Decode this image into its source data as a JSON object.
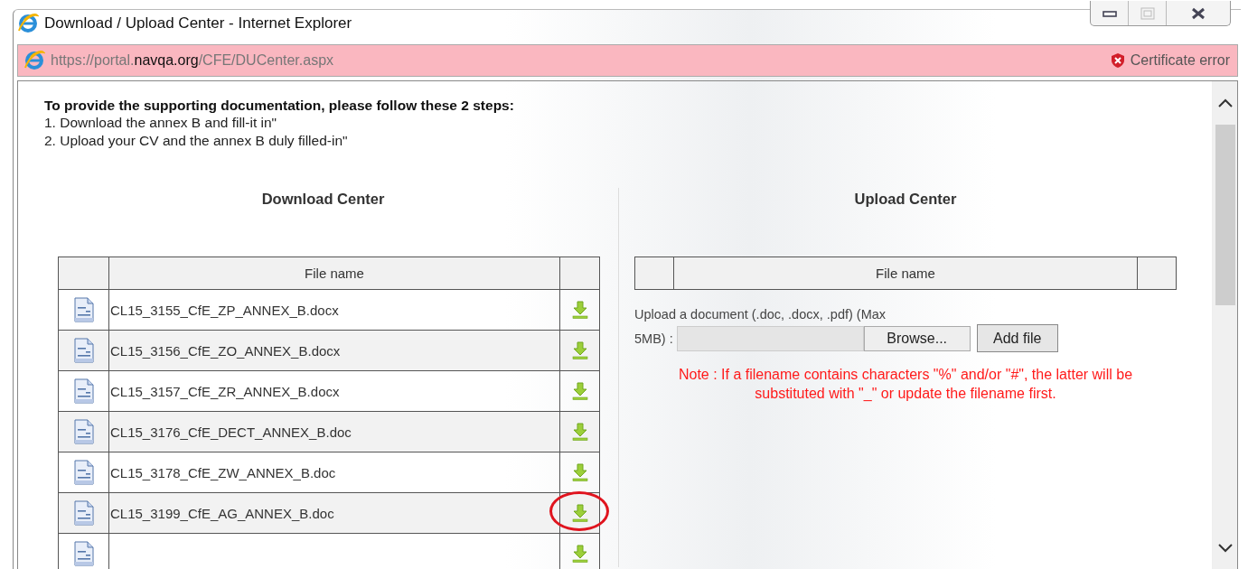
{
  "window": {
    "title": "Download / Upload Center - Internet Explorer",
    "controls": [
      {
        "kind": "minimize",
        "disabled": false
      },
      {
        "kind": "maximize",
        "disabled": true
      },
      {
        "kind": "close",
        "disabled": false
      }
    ]
  },
  "address_bar": {
    "url": "https://portal.**navqa.org**/CFE/DUCenter.aspx",
    "certificate_error": "Certificate error"
  },
  "instructions": {
    "heading": "To provide the supporting documentation, please follow these 2 steps:",
    "steps": [
      "1. Download the annex B and fill-it in\"",
      "2. Upload your CV and the annex B duly filled-in\""
    ]
  },
  "download_center": {
    "title": "Download Center",
    "columns": [
      "File name"
    ],
    "rows": [
      {
        "file_name": "CL15_3155_CfE_ZP_ANNEX_B.docx",
        "circled": false
      },
      {
        "file_name": "CL15_3156_CfE_ZO_ANNEX_B.docx",
        "circled": false
      },
      {
        "file_name": "CL15_3157_CfE_ZR_ANNEX_B.docx",
        "circled": false
      },
      {
        "file_name": "CL15_3176_CfE_DECT_ANNEX_B.doc",
        "circled": false
      },
      {
        "file_name": "CL15_3178_CfE_ZW_ANNEX_B.doc",
        "circled": false
      },
      {
        "file_name": "CL15_3199_CfE_AG_ANNEX_B.doc",
        "circled": true
      },
      {
        "circled": false
      }
    ]
  },
  "upload_center": {
    "title": "Upload Center",
    "columns": [
      "File name"
    ],
    "upload_label": [
      "Upload a document (.doc, .docx, .pdf) (Max",
      "5MB) :"
    ],
    "browse_button": "Browse...",
    "add_button": "Add file",
    "note": "Note : If a filename contains characters \"%\" and/or \"#\", the latter will be substituted with \"_\" or update the filename first."
  }
}
